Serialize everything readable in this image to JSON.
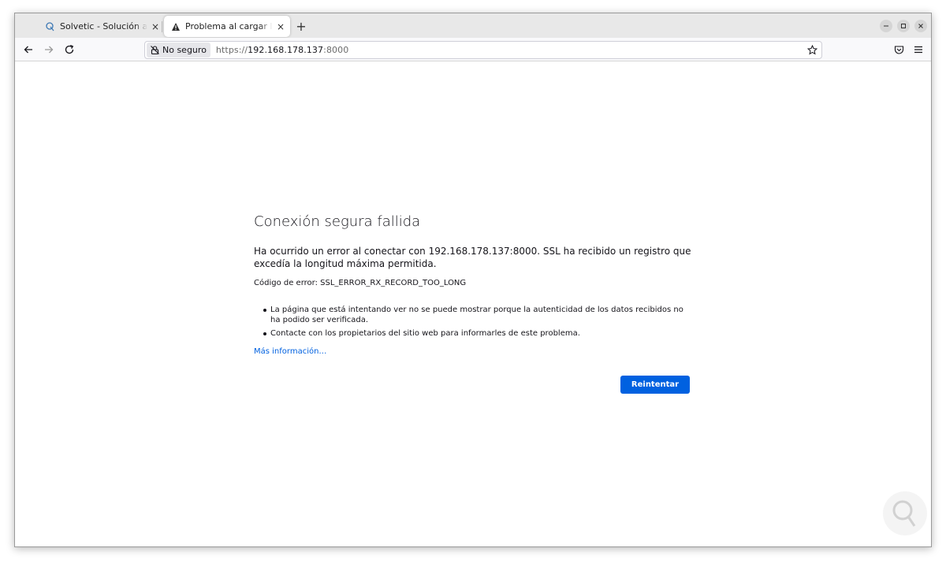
{
  "tabs": [
    {
      "title": "Solvetic - Solución a los p",
      "icon": "solvetic-logo-icon",
      "close": "×",
      "active": false
    },
    {
      "title": "Problema al cargar la pág",
      "icon": "warning-icon",
      "close": "×",
      "active": true
    }
  ],
  "new_tab_label": "+",
  "urlbar": {
    "identity_label": "No seguro",
    "scheme": "https://",
    "host": "192.168.178.137",
    "port": ":8000"
  },
  "error_page": {
    "title": "Conexión segura fallida",
    "description": "Ha ocurrido un error al conectar con 192.168.178.137:8000. SSL ha recibido un registro que excedía la longitud máxima permitida.",
    "error_code": "Código de error: SSL_ERROR_RX_RECORD_TOO_LONG",
    "bullets": [
      "La página que está intentando ver no se puede mostrar porque la autenticidad de los datos recibidos no ha podido ser verificada.",
      "Contacte con los propietarios del sitio web para informarles de este problema."
    ],
    "more_info": "Más información…",
    "retry_button": "Reintentar"
  },
  "colors": {
    "accent": "#0061e0",
    "tabstrip": "#e8e8e8",
    "toolbar": "#f9f9fb"
  }
}
